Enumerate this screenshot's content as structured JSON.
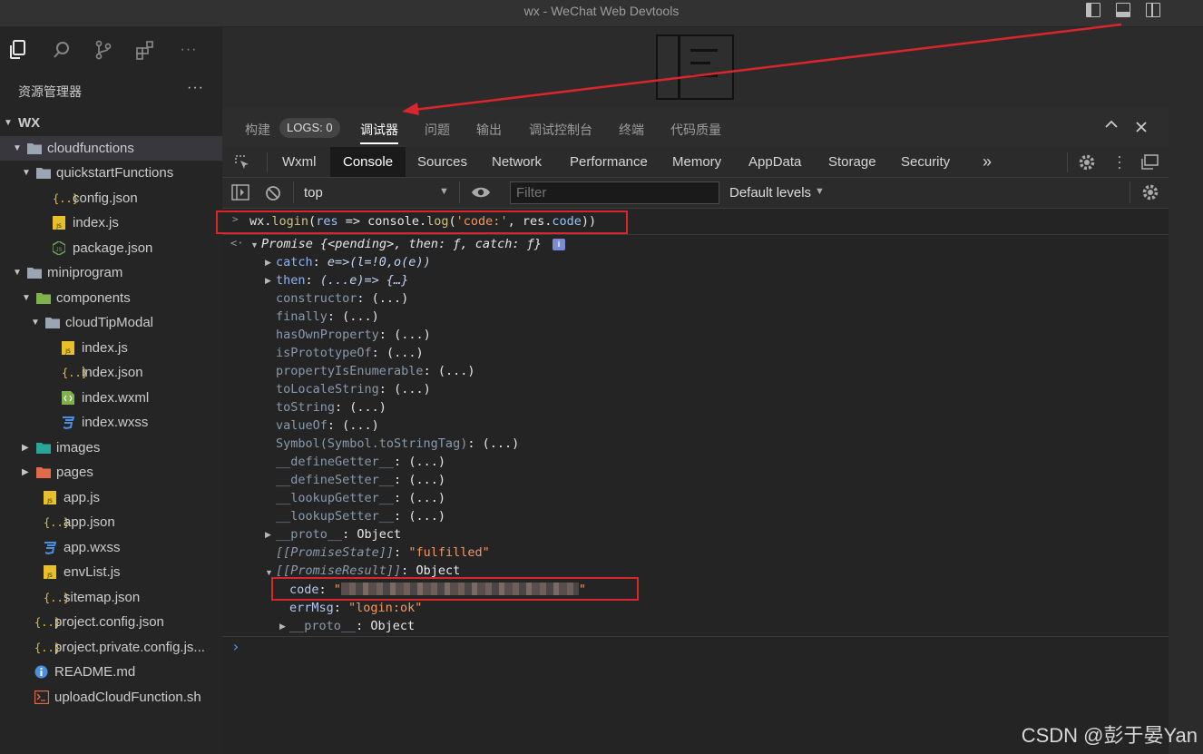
{
  "window": {
    "title": "wx - WeChat Web Devtools"
  },
  "sidebar": {
    "title": "资源管理器",
    "more": "···",
    "tree": [
      {
        "label": "WX",
        "depth": 0,
        "kind": "root",
        "open": true
      },
      {
        "label": "cloudfunctions",
        "depth": 1,
        "kind": "folder",
        "open": true,
        "selected": true
      },
      {
        "label": "quickstartFunctions",
        "depth": 2,
        "kind": "folder",
        "open": true
      },
      {
        "label": "config.json",
        "depth": 3,
        "kind": "json"
      },
      {
        "label": "index.js",
        "depth": 3,
        "kind": "js"
      },
      {
        "label": "package.json",
        "depth": 3,
        "kind": "node"
      },
      {
        "label": "miniprogram",
        "depth": 1,
        "kind": "folder",
        "open": true
      },
      {
        "label": "components",
        "depth": 2,
        "kind": "folder-green",
        "open": true
      },
      {
        "label": "cloudTipModal",
        "depth": 3,
        "kind": "folder",
        "open": true
      },
      {
        "label": "index.js",
        "depth": 4,
        "kind": "js"
      },
      {
        "label": "index.json",
        "depth": 4,
        "kind": "json"
      },
      {
        "label": "index.wxml",
        "depth": 4,
        "kind": "wxml"
      },
      {
        "label": "index.wxss",
        "depth": 4,
        "kind": "wxss"
      },
      {
        "label": "images",
        "depth": 2,
        "kind": "folder-teal",
        "open": false
      },
      {
        "label": "pages",
        "depth": 2,
        "kind": "folder-orange",
        "open": false
      },
      {
        "label": "app.js",
        "depth": 2,
        "kind": "js"
      },
      {
        "label": "app.json",
        "depth": 2,
        "kind": "json"
      },
      {
        "label": "app.wxss",
        "depth": 2,
        "kind": "wxss"
      },
      {
        "label": "envList.js",
        "depth": 2,
        "kind": "js"
      },
      {
        "label": "sitemap.json",
        "depth": 2,
        "kind": "json"
      },
      {
        "label": "project.config.json",
        "depth": 1,
        "kind": "json"
      },
      {
        "label": "project.private.config.js...",
        "depth": 1,
        "kind": "json"
      },
      {
        "label": "README.md",
        "depth": 1,
        "kind": "info"
      },
      {
        "label": "uploadCloudFunction.sh",
        "depth": 1,
        "kind": "shell"
      }
    ]
  },
  "devtools": {
    "tabs": [
      "构建",
      "调试器",
      "问题",
      "输出",
      "调试控制台",
      "终端",
      "代码质量"
    ],
    "logs_badge": "LOGS: 0",
    "active_tab": "调试器",
    "panel_tabs": [
      "Wxml",
      "Console",
      "Sources",
      "Network",
      "Performance",
      "Memory",
      "AppData",
      "Storage",
      "Security"
    ],
    "active_panel": "Console",
    "more_tabs": "»",
    "context": "top",
    "filter_placeholder": "Filter",
    "levels": "Default levels"
  },
  "console": {
    "input": [
      "wx",
      ".",
      "login",
      "(",
      "res",
      " => ",
      "console",
      ".",
      "log",
      "(",
      "'code:'",
      ", ",
      "res",
      ".",
      "code",
      "))"
    ],
    "result_head": "Promise {<pending>, then: ƒ, catch: ƒ}",
    "lines": [
      {
        "key": "catch",
        "sep": ": ",
        "val": "e=>(l=!0,o(e))",
        "expand": true,
        "own": true
      },
      {
        "key": "then",
        "sep": ": ",
        "val": "(...e)=> {…}",
        "expand": true,
        "own": true
      },
      {
        "key": "constructor",
        "sep": ": ",
        "val": "(...)"
      },
      {
        "key": "finally",
        "sep": ": ",
        "val": "(...)"
      },
      {
        "key": "hasOwnProperty",
        "sep": ": ",
        "val": "(...)"
      },
      {
        "key": "isPrototypeOf",
        "sep": ": ",
        "val": "(...)"
      },
      {
        "key": "propertyIsEnumerable",
        "sep": ": ",
        "val": "(...)"
      },
      {
        "key": "toLocaleString",
        "sep": ": ",
        "val": "(...)"
      },
      {
        "key": "toString",
        "sep": ": ",
        "val": "(...)"
      },
      {
        "key": "valueOf",
        "sep": ": ",
        "val": "(...)"
      },
      {
        "key": "Symbol(Symbol.toStringTag)",
        "sep": ": ",
        "val": "(...)"
      },
      {
        "key": "__defineGetter__",
        "sep": ": ",
        "val": "(...)"
      },
      {
        "key": "__defineSetter__",
        "sep": ": ",
        "val": "(...)"
      },
      {
        "key": "__lookupGetter__",
        "sep": ": ",
        "val": "(...)"
      },
      {
        "key": "__lookupSetter__",
        "sep": ": ",
        "val": "(...)"
      },
      {
        "key": "__proto__",
        "sep": ": ",
        "val": "Object",
        "expand": true
      }
    ],
    "promise_state_key": "[[PromiseState]]",
    "promise_state_val": "\"fulfilled\"",
    "promise_result_key": "[[PromiseResult]]",
    "promise_result_val": "Object",
    "code_key": "code",
    "code_val_open": "\"",
    "code_val_close": "\"",
    "errmsg_key": "errMsg",
    "errmsg_val": "\"login:ok\"",
    "proto_key": "__proto__",
    "proto_val": "Object",
    "prompt": "›"
  },
  "watermark": "CSDN @彭于晏Yan",
  "colors": {
    "annotation": "#d9262c"
  }
}
